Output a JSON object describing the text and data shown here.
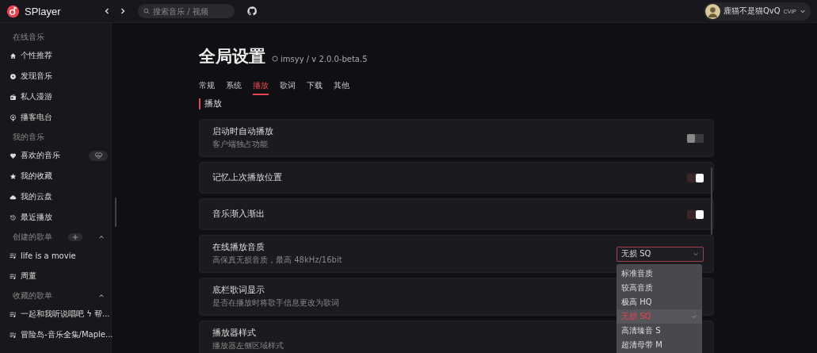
{
  "app": {
    "name": "SPlayer"
  },
  "topbar": {
    "search_placeholder": "搜索音乐 / 视频",
    "user": {
      "name": "鹿猫不是猫QvQ",
      "badge": "CVIP"
    }
  },
  "sidebar": {
    "sections": [
      {
        "title": "在线音乐",
        "items": [
          {
            "label": "个性推荐"
          },
          {
            "label": "发现音乐"
          },
          {
            "label": "私人漫游"
          },
          {
            "label": "播客电台"
          }
        ]
      },
      {
        "title": "我的音乐",
        "items": [
          {
            "label": "喜欢的音乐",
            "heartbeat": true
          },
          {
            "label": "我的收藏"
          },
          {
            "label": "我的云盘"
          },
          {
            "label": "最近播放"
          }
        ]
      },
      {
        "title": "创建的歌单",
        "add": true,
        "expanded": true,
        "items": [
          {
            "label": "life is a movie"
          },
          {
            "label": "周董"
          }
        ]
      },
      {
        "title": "收藏的歌单",
        "expanded": true,
        "items": [
          {
            "label": "一起和我听说唱吧 ϟ 帮..."
          },
          {
            "label": "冒险岛-音乐全集/Maple..."
          }
        ]
      }
    ]
  },
  "page": {
    "title": "全局设置",
    "repo": "imsyy / v 2.0.0-beta.5",
    "tabs": [
      {
        "label": "常规",
        "selected": false
      },
      {
        "label": "系统",
        "selected": false
      },
      {
        "label": "播放",
        "selected": true
      },
      {
        "label": "歌词",
        "selected": false
      },
      {
        "label": "下载",
        "selected": false
      },
      {
        "label": "其他",
        "selected": false
      }
    ],
    "section": "播放",
    "settings": [
      {
        "kind": "switch",
        "title": "启动时自动播放",
        "desc": "客户端独占功能",
        "on": false
      },
      {
        "kind": "switch",
        "title": "记忆上次播放位置",
        "on": true
      },
      {
        "kind": "switch",
        "title": "音乐渐入渐出",
        "on": true
      },
      {
        "kind": "select",
        "title": "在线播放音质",
        "desc": "高保真无损音质，最高 48kHz/16bit",
        "value": "无损 SQ",
        "open": true,
        "options": [
          {
            "label": "标准音质",
            "selected": false
          },
          {
            "label": "较高音质",
            "selected": false
          },
          {
            "label": "极高 HQ",
            "selected": false
          },
          {
            "label": "无损 SQ",
            "selected": true
          },
          {
            "label": "高清臻音 S",
            "selected": false
          },
          {
            "label": "超清母带 M",
            "selected": false
          }
        ]
      },
      {
        "kind": "plain",
        "title": "底栏歌词显示",
        "desc": "是否在播放时将歌手信息更改为歌词"
      },
      {
        "kind": "plain",
        "title": "播放器样式",
        "desc": "播放器左侧区域样式"
      }
    ]
  }
}
